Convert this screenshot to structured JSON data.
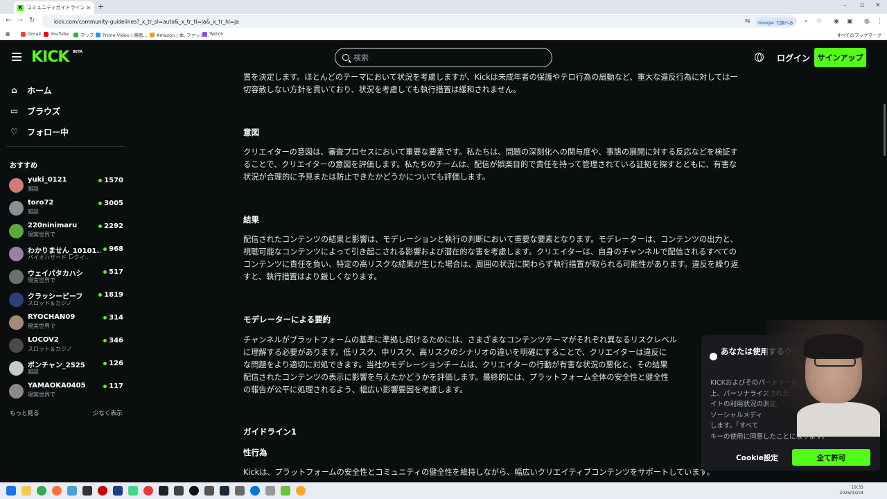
{
  "browser": {
    "tab_title": "コミュニティガイドライン - キックストリ...",
    "tab_favicon": "K",
    "url": "kick.com/community-guidelines?_x_tr_sl=auto&_x_tr_tl=ja&_x_tr_hl=ja",
    "google_translate_label": "Google で調べる",
    "bookmarks": [
      "Gmail",
      "YouTube",
      "マップ",
      "Prime Video | 映画...",
      "Amazon | 本, ファッシ...",
      "Twitch"
    ],
    "all_bookmarks": "すべてのブックマーク"
  },
  "header": {
    "logo": "KICK",
    "beta": "BETA",
    "search_placeholder": "検索",
    "login": "ログイン",
    "signup": "サインアップ"
  },
  "sidebar": {
    "nav": [
      {
        "label": "ホーム",
        "icon": "home-icon"
      },
      {
        "label": "ブラウズ",
        "icon": "browse-icon"
      },
      {
        "label": "フォロー中",
        "icon": "heart-icon"
      }
    ],
    "recommended_label": "おすすめ",
    "channels": [
      {
        "name": "yuki_0121",
        "category": "雑談",
        "viewers": "1570",
        "color": "#d07a7a"
      },
      {
        "name": "toro72",
        "category": "雑談",
        "viewers": "3005",
        "color": "#8a8f93"
      },
      {
        "name": "220ninimaru",
        "category": "現実世界で",
        "viewers": "2292",
        "color": "#5ca83a"
      },
      {
        "name": "わかりません_10101...",
        "category": "バイオハザード レクイ...",
        "viewers": "968",
        "color": "#9b7fa8"
      },
      {
        "name": "ウェイパタカハシ",
        "category": "現実世界で",
        "viewers": "517",
        "color": "#6e6e6e"
      },
      {
        "name": "クラッシービーフ",
        "category": "スロット＆カジノ",
        "viewers": "1819",
        "color": "#2c3f7a"
      },
      {
        "name": "RYOCHAN09",
        "category": "現実世界で",
        "viewers": "314",
        "color": "#a38a78"
      },
      {
        "name": "LOCOV2",
        "category": "スロット＆カジノ",
        "viewers": "346",
        "color": "#4a4a4a"
      },
      {
        "name": "ボンチャン_2525",
        "category": "雑談",
        "viewers": "126",
        "color": "#c9c9c9"
      },
      {
        "name": "YAMAOKA0405",
        "category": "現実世界で",
        "viewers": "117",
        "color": "#8b8b8b"
      }
    ],
    "show_more": "もっと見る",
    "show_less": "少なく表示"
  },
  "content": {
    "intro_lines": [
      "置を決定します。ほとんどのテーマにおいて状況を考慮しますが、Kickは未成年者の保護やテロ行為の扇動など、重大な違反行為に対しては一",
      "切容赦しない方針を貫いており、状況を考慮しても執行措置は緩和されません。"
    ],
    "sections": [
      {
        "heading": "意図",
        "lines": [
          "クリエイターの意図は、審査プロセスにおいて重要な要素です。私たちは、問題の深刻化への関与度や、事態の展開に対する反応などを検証す",
          "ることで、クリエイターの意図を評価します。私たちのチームは、配信が娯楽目的で責任を持って管理されている証拠を探すとともに、有害な",
          "状況が合理的に予見または防止できたかどうかについても評価します。"
        ]
      },
      {
        "heading": "結果",
        "lines": [
          "配信されたコンテンツの結果と影響は、モデレーションと執行の判断において重要な要素となります。モデレーターは、コンテンツの出力と、",
          "視聴可能なコンテンツによって引き起こされる影響および潜在的な害を考慮します。クリエイターは、自身のチャンネルで配信されるすべての",
          "コンテンツに責任を負い、特定の高リスクな結果が生じた場合は、周囲の状況に関わらず執行措置が取られる可能性があります。違反を繰り返",
          "すと、執行措置はより厳しくなります。"
        ]
      },
      {
        "heading": "モデレーターによる要約",
        "lines": [
          "チャンネルがプラットフォームの基準に準拠し続けるためには、さまざまなコンテンツテーマがそれぞれ異なるリスクレベル",
          "に理解する必要があります。低リスク、中リスク、高リスクのシナリオの違いを明確にすることで、クリエイターは違反に",
          "な問題をより適切に対処できます。当社のモデレーションチームは、クリエイターの行動が有害な状況の悪化と、その結果",
          "配信されたコンテンツの表示に影響を与えたかどうかを評価します。最終的には、プラットフォーム全体の安全性と健全性",
          "の報告が公平に処理されるよう、幅広い影響要因を考慮します。"
        ]
      }
    ],
    "guideline_heading": "ガイドライン1",
    "guideline_sub": "性行為",
    "guideline_line": "Kickは、プラットフォームの安全性とコミュニティの健全性を維持しながら、幅広いクリエイティブコンテンツをサポートしています。"
  },
  "cookie": {
    "title": "あなたは使用するクッキー... ます",
    "body_lines": [
      "KICKおよびそのパートナーは、",
      "上、パーソナライズされた",
      "イトの利用状況の測定、",
      "ソーシャルメディ",
      "します。「すべて",
      "キーの使用に同意したことになります。"
    ],
    "settings_button": "Cookie設定",
    "accept_button": "全て許可"
  },
  "taskbar": {
    "time": "19:33",
    "date": "2026/03/24"
  }
}
